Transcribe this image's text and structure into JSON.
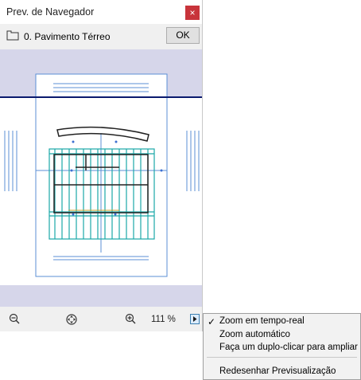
{
  "window": {
    "title": "Prev. de Navegador",
    "close_glyph": "×"
  },
  "view": {
    "name": "0. Pavimento Térreo",
    "icon": "floor-plan-view-icon",
    "ok_label": "OK"
  },
  "toolbar": {
    "zoom_out_icon": "zoom-out-icon",
    "fit_icon": "zoom-fit-icon",
    "zoom_in_icon": "zoom-in-icon",
    "zoom_value": "111 %",
    "menu_icon": "triangle-right-icon"
  },
  "menu": {
    "items": [
      {
        "label": "Zoom em tempo-real",
        "checked": true
      },
      {
        "label": "Zoom automático",
        "checked": false
      },
      {
        "label": "Faça um duplo-clicar para ampliar",
        "checked": false
      },
      {
        "label": "Redesenhar Previsualização",
        "checked": false
      }
    ]
  },
  "colors": {
    "accent": "#c8343b",
    "preview_band": "#d6d6ea",
    "plan_lines": "#5b8fd6",
    "structure": "#1aa8a8",
    "border_line": "#0a1a6e"
  }
}
